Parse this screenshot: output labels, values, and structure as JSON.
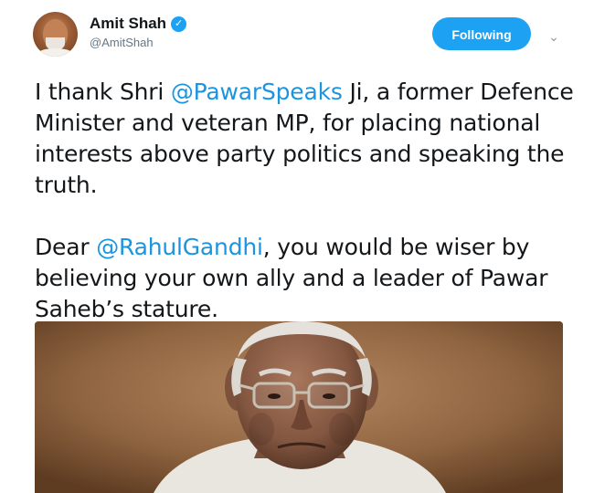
{
  "tweet": {
    "author": {
      "display_name": "Amit Shah",
      "handle": "@AmitShah",
      "verified_icon": "✓"
    },
    "follow_button_label": "Following",
    "caret_icon": "⌄",
    "paragraph1": {
      "prefix": "I thank Shri ",
      "mention": "@PawarSpeaks",
      "suffix": " Ji, a former Defence Minister and veteran MP, for placing national interests above party politics and speaking the truth."
    },
    "paragraph2": {
      "prefix": "Dear ",
      "mention": "@RahulGandhi",
      "suffix": ", you would be wiser by believing your own ally and a leader of Pawar Saheb’s stature."
    }
  },
  "icons": {
    "avatar": "avatar-photo",
    "verified": "verified-badge-icon",
    "caret": "chevron-down-icon"
  },
  "colors": {
    "accent": "#1da1f2",
    "mention": "#1b95e0",
    "text": "#14171a",
    "muted": "#657786"
  }
}
